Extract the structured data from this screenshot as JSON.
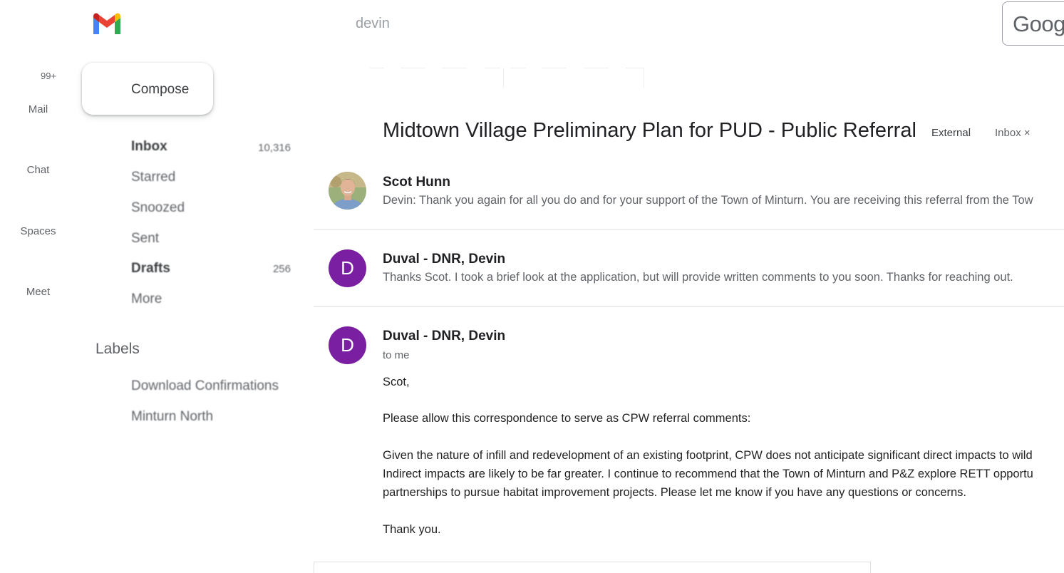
{
  "app": {
    "name": "Gmail"
  },
  "header": {
    "search_text": "devin",
    "account_logo_text": "Goog"
  },
  "rail": {
    "badge": "99+",
    "items": [
      {
        "label": "Mail"
      },
      {
        "label": "Chat"
      },
      {
        "label": "Spaces"
      },
      {
        "label": "Meet"
      }
    ]
  },
  "compose": {
    "label": "Compose"
  },
  "nav": {
    "items": [
      {
        "label": "Inbox",
        "count": "10,316"
      },
      {
        "label": "Starred",
        "count": ""
      },
      {
        "label": "Snoozed",
        "count": ""
      },
      {
        "label": "Sent",
        "count": ""
      },
      {
        "label": "Drafts",
        "count": "256"
      },
      {
        "label": "More",
        "count": ""
      }
    ],
    "labels_heading": "Labels",
    "labels": [
      {
        "label": "Download Confirmations"
      },
      {
        "label": "Minturn North"
      }
    ]
  },
  "thread": {
    "subject": "Midtown Village Preliminary Plan for PUD - Public Referral",
    "tags": {
      "external": "External",
      "inbox": "Inbox ×"
    },
    "messages": [
      {
        "sender": "Scot Hunn",
        "snippet": "Devin: Thank you again for all you do and for your support of the Town of Minturn. You are receiving this referral from the Tow"
      },
      {
        "sender": "Duval - DNR, Devin",
        "avatar_letter": "D",
        "snippet": "Thanks Scot. I took a brief look at the application, but will provide written comments to you soon. Thanks for reaching out."
      },
      {
        "sender": "Duval - DNR, Devin",
        "avatar_letter": "D",
        "to": "to me",
        "body": {
          "greeting": "Scot,",
          "p1": "Please allow this correspondence to serve as CPW referral comments:",
          "p2_l1": "Given the nature of infill and redevelopment of an existing footprint, CPW does not anticipate significant direct impacts to wild",
          "p2_l2": "Indirect impacts are likely to be far greater. I continue to recommend that the Town of Minturn and P&Z explore RETT opportu",
          "p2_l3": "partnerships to pursue habitat improvement projects. Please let me know if you have any questions or concerns.",
          "closing": "Thank you."
        }
      }
    ]
  },
  "colors": {
    "avatar_purple": "#7b1fa2",
    "text_primary": "#202124",
    "text_secondary": "#5f6368"
  }
}
